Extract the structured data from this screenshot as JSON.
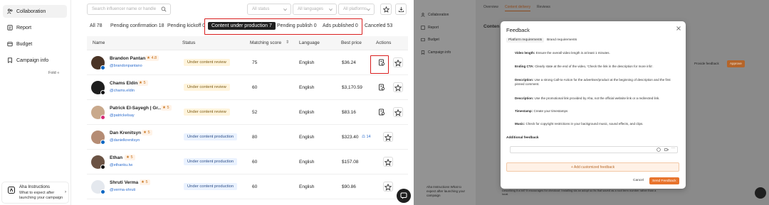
{
  "left": {
    "sidebar": {
      "items": [
        {
          "label": "Collaboration",
          "icon": "people-icon"
        },
        {
          "label": "Report",
          "icon": "report-icon"
        },
        {
          "label": "Budget",
          "icon": "budget-icon"
        },
        {
          "label": "Campaign info",
          "icon": "info-icon"
        }
      ],
      "fold_label": "Fold",
      "aha": {
        "title": "Aha Instructions",
        "text": "What to expect after launching your campaign"
      }
    },
    "toolbar": {
      "search_placeholder": "Search influencer name or handle",
      "filters": [
        "All status",
        "All languages",
        "All platforms"
      ]
    },
    "tabs": [
      {
        "label": "All 78"
      },
      {
        "label": "Pending confirmation 18"
      },
      {
        "label": "Pending kickoff 0"
      },
      {
        "label": "Content under production 7"
      },
      {
        "label": "Pending publish 0"
      },
      {
        "label": "Ads published 0"
      },
      {
        "label": "Canceled 53"
      }
    ],
    "table": {
      "columns": [
        "Name",
        "Status",
        "Matching score",
        "Language",
        "Best price",
        "Actions"
      ],
      "rows": [
        {
          "name": "Brandon Pantano",
          "rating": "4.8",
          "handle": "@brandonpantano",
          "status": "Under content review",
          "score": "75",
          "language": "English",
          "price": "$36.24",
          "platform": "linkedin",
          "extra": ""
        },
        {
          "name": "Chams Eldin",
          "rating": "5",
          "handle": "@chams.eldin",
          "status": "Under content review",
          "score": "60",
          "language": "English",
          "price": "$3,170.59",
          "platform": "tiktok",
          "extra": ""
        },
        {
          "name": "Patrick El-Sayegh | Gr...",
          "rating": "5",
          "handle": "@patrickelsay",
          "status": "Under content review",
          "score": "52",
          "language": "English",
          "price": "$83.16",
          "platform": "instagram",
          "extra": ""
        },
        {
          "name": "Dan Krenitsyn",
          "rating": "5",
          "handle": "@danielkrenitsyn",
          "status": "Under content production",
          "score": "80",
          "language": "English",
          "price": "$323.40",
          "platform": "linkedin",
          "extra": "14"
        },
        {
          "name": "Ethan",
          "rating": "5",
          "handle": "@ethanku.tw",
          "status": "Under content production",
          "score": "60",
          "language": "English",
          "price": "$157.08",
          "platform": "tiktok",
          "extra": ""
        },
        {
          "name": "Shruti Verma",
          "rating": "5",
          "handle": "@verma-shruti",
          "status": "Under content production",
          "score": "60",
          "language": "English",
          "price": "$90.86",
          "platform": "linkedin",
          "extra": ""
        }
      ]
    }
  },
  "right": {
    "bg": {
      "nav": [
        "Collaboration",
        "Report",
        "Budget",
        "Campaign info"
      ],
      "tabs": [
        "Overview",
        "Content delivery",
        "Reviews"
      ],
      "heading": "Conten",
      "provide_feedback": "Provide feedback",
      "approve": "Approve",
      "aha": "Aha Instructions What to expect after launching your campaign",
      "bottom_text": "Describing it a bit? It encourages for checkout. Installing via an adopt so its that saved as a root term number rather than a local."
    },
    "modal": {
      "title": "Feedback",
      "tabs": [
        "Platform requirements",
        "Brand requirements"
      ],
      "items": [
        {
          "label": "Video length:",
          "text": "Ensure the overall video length is at least 1 minutes."
        },
        {
          "label": "Ending CTA:",
          "text": "Clearly state at the end of the video, 'Check the link in the description for more info'."
        },
        {
          "label": "Description:",
          "text": "Use a strong Call-to-Action for the advertiser/product at the beginning of description and the first pinned comment."
        },
        {
          "label": "Description:",
          "text": "Use the promotional link provided by Aha, not the official website link or a redirected link."
        },
        {
          "label": "Timestamp:",
          "text": "Create your timestamps"
        },
        {
          "label": "Music:",
          "text": "Check for copyright restrictions in your background music, sound effects, and clips."
        }
      ],
      "additional_label": "Additional feedback",
      "add_button": "+ Add customized feedback",
      "cancel": "Cancel",
      "send": "Send Feedback"
    }
  }
}
